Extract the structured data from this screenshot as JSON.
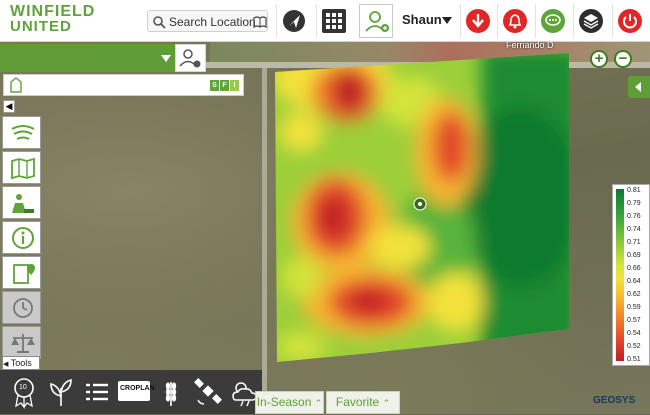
{
  "app": {
    "logo_line1": "WINFIELD",
    "logo_line2": "UNITED"
  },
  "header": {
    "search_label": "Search Location",
    "user_name": "Shaun",
    "accent": "#5fa33b"
  },
  "map": {
    "road_label": "Fernando D",
    "legend": [
      "0.81",
      "0.79",
      "0.76",
      "0.74",
      "0.71",
      "0.69",
      "0.66",
      "0.64",
      "0.62",
      "0.59",
      "0.57",
      "0.54",
      "0.52",
      "0.51"
    ],
    "heat_colors": [
      "#c01f26",
      "#e2462a",
      "#f07c2c",
      "#f6b533",
      "#f3e23a",
      "#d3e43a",
      "#9ccf3a",
      "#57b33a",
      "#27963a",
      "#0f7a2e"
    ]
  },
  "panel": {
    "tags": [
      "S",
      "F",
      "I"
    ]
  },
  "sidebar": {
    "tools_label": "Tools"
  },
  "bottom": {
    "tab_in_season": "In-Season",
    "tab_favorite": "Favorite",
    "cropplan_label": "CROPLAN",
    "badge_number": "10"
  },
  "brand": {
    "geosys": "GEOSYS"
  }
}
